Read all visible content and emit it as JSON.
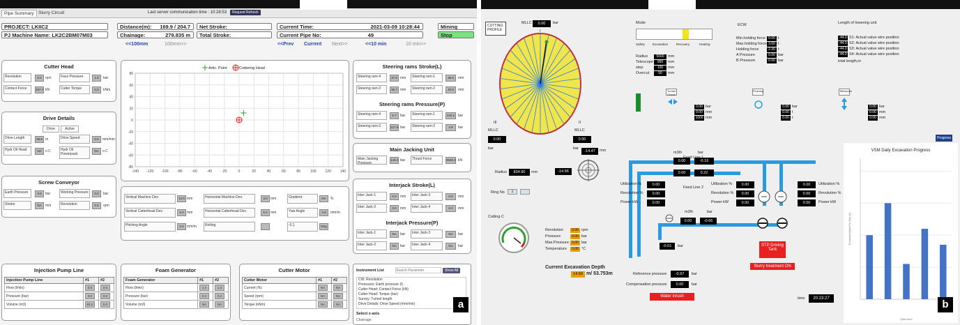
{
  "panel_a": {
    "tabs": [
      "Pipe Summary",
      "Slurry Circuit"
    ],
    "server_time_label": "Last server communication time : 10:28:53",
    "request_button": "Request Refresh",
    "project": "PROJECT: LKIIC2",
    "machine": "PJ Machine Name: LK2C2BM07M03",
    "distance_label": "Distance(m):",
    "distance_value": "169.9 / 204.7",
    "chainage_label": "Chainage:",
    "chainage_value": "279.835 m",
    "net_stroke": "Net Stroke:",
    "total_stroke": "Total Stroke:",
    "current_time_label": "Current Time:",
    "current_time_value": "2021-03-09 10:28:44",
    "current_pipe_label": "Current Pipe No:",
    "current_pipe_value": "49",
    "mode_mining": "Mining",
    "mode_stop": "Stop",
    "nav_left": [
      "<<100mm",
      "100mm>>"
    ],
    "nav_right": [
      "<<Prev",
      "Current",
      "Next>>",
      "<<10 min",
      "10 min>>"
    ],
    "cutter_head": {
      "title": "Cutter Head",
      "rows": [
        [
          "Revolution",
          "0.0",
          "rpm",
          "Face Pressure",
          "1.8",
          "bar"
        ],
        [
          "Contact Force",
          "157.7",
          "kN",
          "Cutter Torque",
          "0.0",
          "kNm"
        ]
      ]
    },
    "drive_details": {
      "title": "Drive Details",
      "headers": [
        "Drive",
        "Active"
      ],
      "rows": [
        [
          "Drive Length",
          "39.6",
          "m",
          "Drive Speed",
          "0.0",
          "mm/min"
        ],
        [
          "Hydr Oil Head",
          "NA",
          "o C",
          "Hydr Oil Powerpack",
          "NA",
          "o C"
        ]
      ]
    },
    "screw": {
      "title": "Screw Conveyor",
      "rows": [
        [
          "Earth Pressure",
          "3.6",
          "bar",
          "Working Pressure",
          "0.0",
          "bar"
        ],
        [
          "Stroke",
          "NA",
          "mm",
          "Revolution",
          "0.0",
          "rpm"
        ]
      ]
    },
    "plot": {
      "legend": [
        "Artic. Point",
        "Cuttering Head"
      ],
      "xticks": [
        "-140",
        "-120",
        "-100",
        "-80",
        "-60",
        "-40",
        "-20",
        "0",
        "20",
        "40",
        "60",
        "80",
        "100",
        "120",
        "140"
      ],
      "yticks": [
        "80",
        "60",
        "40",
        "20",
        "0",
        "-20",
        "-40",
        "-60",
        "-80"
      ]
    },
    "chart_data": {
      "type": "scatter",
      "series": [
        {
          "name": "Artic. Point",
          "x": [
            6
          ],
          "y": [
            12
          ]
        },
        {
          "name": "Cuttering Head",
          "x": [
            0
          ],
          "y": [
            0
          ]
        }
      ],
      "xlim": [
        -140,
        140
      ],
      "ylim": [
        -80,
        80
      ],
      "grid": true,
      "legend": "top-center"
    },
    "deviation": {
      "rows": [
        [
          "Vertical Machine Dev.",
          "12.0",
          "mm",
          "Horizontal Machine Dev.",
          "3.0",
          "mm",
          "Gradient",
          "NA",
          "%"
        ],
        [
          "Vertical Catterhead Dev.",
          "0.0",
          "mm",
          "Horizontal Catterhead Dev.",
          "5.0",
          "mm",
          "Yaw Angle",
          "2.8",
          "mm/m"
        ],
        [
          "Pitching Angle",
          "3.3",
          "mm/m",
          "Rolling",
          "",
          "",
          "-0.1",
          "Deg",
          ""
        ]
      ]
    },
    "steer_stroke": {
      "title": "Steering rams Stroke(L)",
      "rows": [
        [
          "Steering ram-4",
          "37.6",
          "mm",
          "Steering ram-1",
          "39.6",
          "mm"
        ],
        [
          "Steering ram-3",
          "36.7",
          "mm",
          "Steering ram-2",
          "40.8",
          "mm"
        ]
      ]
    },
    "steer_pressure": {
      "title": "Steering rams Pressure(P)",
      "rows": [
        [
          "Steering ram-4",
          "6.7",
          "bar",
          "Steering ram-1",
          "220.1",
          "bar"
        ],
        [
          "Steering ram-3",
          "227.5",
          "bar",
          "Steering ram-2",
          "4.9",
          "bar"
        ]
      ]
    },
    "main_jack": {
      "title": "Main Jacking Unit",
      "rows": [
        [
          "Main Jacking Pressure",
          "140.2",
          "bar",
          "Thrust Force",
          "3948.3",
          "kN"
        ]
      ]
    },
    "interjack_stroke": {
      "title": "Interjack Stroke(L)",
      "rows": [
        [
          "Inter Jack-1",
          "0.0",
          "mm",
          "Inter Jack-3",
          "0.0",
          "mm"
        ],
        [
          "Inter Jack-2",
          "0.0",
          "mm",
          "Inter Jack-4",
          "0.0",
          "mm"
        ]
      ]
    },
    "interjack_pressure": {
      "title": "Interjack Pressure(P)",
      "rows": [
        [
          "Inter Jack-1",
          "NA",
          "bar",
          "Inter Jack-3",
          "NA",
          "bar"
        ],
        [
          "Inter Jack-2",
          "NA",
          "bar",
          "Inter Jack-4",
          "NA",
          "bar"
        ]
      ]
    },
    "injection": {
      "title": "Injection Pump Line",
      "headers": [
        "Injection Pump Line",
        "#1",
        "#2"
      ],
      "rows": [
        [
          "Flow (l/min)",
          "0.0",
          "0.0"
        ],
        [
          "Pressure (bar)",
          "0.0",
          "0.0"
        ],
        [
          "Volume (m3)",
          "91.2",
          "0.0"
        ]
      ]
    },
    "foam": {
      "title": "Foam Generator",
      "headers": [
        "Foam Generator",
        "#1",
        "#2"
      ],
      "rows": [
        [
          "Flow (l/min)",
          "1.4",
          "1.3"
        ],
        [
          "Pressure (bar)",
          "0.2",
          "0.2"
        ],
        [
          "Volume (m3)",
          "NA",
          "NA"
        ]
      ]
    },
    "cutter_motor": {
      "title": "Cutter Motor",
      "headers": [
        "Cutter Motor",
        "#1",
        "#2"
      ],
      "rows": [
        [
          "Current (%)",
          "NA",
          "NA"
        ],
        [
          "Speed (rpm)",
          "NA",
          "NA"
        ],
        [
          "Torque (kNm)",
          "NA",
          "NA"
        ]
      ]
    },
    "instrument": {
      "title": "Instrument List",
      "search_placeholder": "Search Parameter",
      "show_all": "Show All",
      "items": [
        "CW: Revolution",
        "Pressures: Earth pressure (l)",
        "Cutter Head: Contact Force (kN)",
        "Cutter Head: Torque (bar)",
        "Survey: Tunnel length",
        "Drive Details: Drive Speed (mm/min)"
      ],
      "select_label": "Select x-axis",
      "select_value": "Chainage"
    },
    "badge": "a"
  },
  "panel_b": {
    "cutting_profile": "CUTTING PROFILE",
    "mllc_label": "MLLC",
    "mllc_value": "0.00",
    "bar": "bar",
    "roman": [
      "I",
      "II",
      "III"
    ],
    "mllc3_value": "0.00",
    "mllc2_value": "0.00",
    "val_1447": "-14.47",
    "val_1496": "-14.96",
    "mm": "mm",
    "radius_label": "Radius",
    "radius_value": "834.90",
    "ring_label": "Ring No",
    "ring_value": "1",
    "mode_title": "Mode",
    "mode_labels": [
      "Safety",
      "Excavation",
      "Recovery",
      "Heating"
    ],
    "mode_rows": [
      [
        "Radius",
        "5000",
        "mm"
      ],
      [
        "Telescope",
        "950",
        "mm"
      ],
      [
        "step",
        "100",
        "mm"
      ],
      [
        "Overcut",
        "50",
        "mm"
      ]
    ],
    "ecw_title": "ECW",
    "ecw_rows": [
      [
        "Min.holding force",
        "0.00",
        "t"
      ],
      [
        "Max.holding force",
        "3.00",
        "t"
      ],
      [
        "Holding force",
        "2.30",
        "t"
      ],
      [
        "A Pressure",
        "0.00",
        "bar"
      ],
      [
        "B Pressure",
        "0.00",
        "bar"
      ]
    ],
    "lowering_title": "Length of lowering unit",
    "lowering_rows": [
      [
        "-44.0",
        "S1: Actual value wire position"
      ],
      [
        "-44.0",
        "S2: Actual value wire position"
      ],
      [
        "-44.0",
        "S3: Actual value wire position"
      ],
      [
        "-44.0",
        "S4: Actual value wire position"
      ]
    ],
    "lowering_total": "total length,m",
    "icons": [
      "Tunnel Check",
      "Flushing",
      "Telescope"
    ],
    "small_vals_1": [
      [
        "0.00",
        "bar"
      ],
      [
        "0.00",
        "mm"
      ],
      [
        "1000",
        "mm"
      ]
    ],
    "small_vals_2": [
      [
        "0.00",
        "bar"
      ],
      [
        "0.00",
        "t"
      ],
      [
        "0.00",
        "t"
      ]
    ],
    "small_vals_3": [
      [
        "0.00",
        "bar"
      ],
      [
        "0.00",
        "mm"
      ],
      [
        "0.00",
        "mm"
      ]
    ],
    "feed1": "Feed Line 1",
    "feed2": "Feed Line 2",
    "m3h": "m3/h",
    "feed1_vals": [
      "0.00",
      "-0.16"
    ],
    "feed2_vals": [
      "0.00",
      "0.22"
    ],
    "left_stats": [
      [
        "Utilization %",
        "0.00"
      ],
      [
        "Revolution %",
        "0.00"
      ],
      [
        "Power kW",
        "0.00"
      ]
    ],
    "mid_stats": [
      [
        "Utilization %",
        "0.00"
      ],
      [
        "Revolution %",
        "0.00"
      ],
      [
        "Power kW",
        "0.00"
      ]
    ],
    "right_stats": [
      [
        "0.00",
        "Utilization %"
      ],
      [
        "0.00",
        "Revolution %"
      ],
      [
        "0.00",
        "Power kW"
      ]
    ],
    "bottom_line": [
      "0.00",
      "-0.66"
    ],
    "val_001": "-0.01",
    "stp": "STP Driving Tank",
    "slurry_on": "Slurry treatment ON",
    "cutting_c": "Cutting C",
    "cut_stats": [
      [
        "Revolution",
        "0.00",
        "rpm"
      ],
      [
        "Pressure",
        "0.00",
        "bar"
      ],
      [
        "Max.Pressure",
        "0.00",
        "bar"
      ],
      [
        "Temperature",
        "0.00",
        "°C"
      ]
    ],
    "current_exc": "Current Excavation Depth",
    "exc_val": "14.69",
    "exc_rest": "m/ 53.753m",
    "ref_label": "Reference pressure",
    "ref_val": "-0.97",
    "comp_label": "Compensation pressure",
    "comp_val": "0.00",
    "water_inrush": "Water inrush",
    "time_label": "time",
    "time_value": "20:23:27",
    "progress_button": "Progress",
    "chart_title": "VSM Daily Excavation Progress",
    "chart_ylabel": "Excavated Depth Per Day (m)",
    "chart_xlabel": "Date time",
    "chart_data": {
      "type": "bar",
      "values": [
        1.0,
        1.5,
        0.55,
        1.1,
        0.85
      ],
      "ylim": [
        0,
        2.2
      ],
      "title": "VSM Daily Excavation Progress",
      "xlabel": "Date time",
      "ylabel": "Excavated Depth Per Day (m)"
    },
    "badge": "b"
  }
}
